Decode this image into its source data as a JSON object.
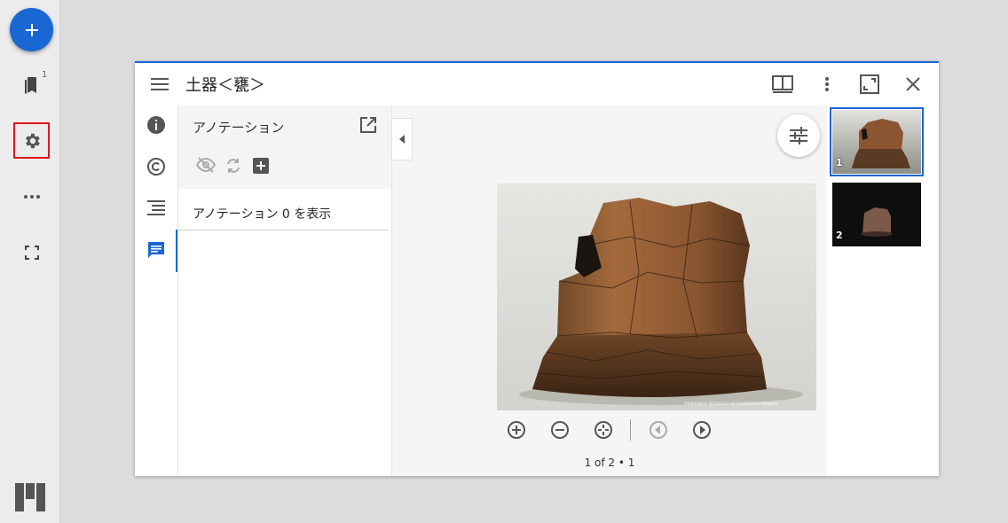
{
  "rail": {
    "add_label": "+",
    "bookmark_badge": "1",
    "items": [
      {
        "name": "bookmark-icon"
      },
      {
        "name": "settings-icon"
      },
      {
        "name": "more-icon"
      },
      {
        "name": "fullscreen-icon"
      }
    ]
  },
  "window": {
    "title": "土器＜甕＞",
    "accent_color": "#1967d2",
    "toolbar_icons": [
      "menu-icon",
      "book-view-icon",
      "more-vert-icon",
      "maximize-icon",
      "close-icon"
    ]
  },
  "sidebar": {
    "icons": [
      "info-icon",
      "copyright-icon",
      "toc-icon",
      "annotation-icon"
    ],
    "active": "annotation-icon"
  },
  "annotation_panel": {
    "title": "アノテーション",
    "toggle_row": "アノテーション 0 を表示",
    "tools": [
      "visibility-off-icon",
      "sync-icon",
      "add-box-icon"
    ]
  },
  "viewer": {
    "watermark": "Hokkaido Museum of Northern Peoples",
    "controls": [
      "zoom-in-icon",
      "zoom-out-icon",
      "reset-icon",
      "prev-icon",
      "next-icon"
    ],
    "pager": "1 of 2 • 1"
  },
  "thumbnails": [
    {
      "number": "1",
      "selected": true
    },
    {
      "number": "2",
      "selected": false
    }
  ]
}
